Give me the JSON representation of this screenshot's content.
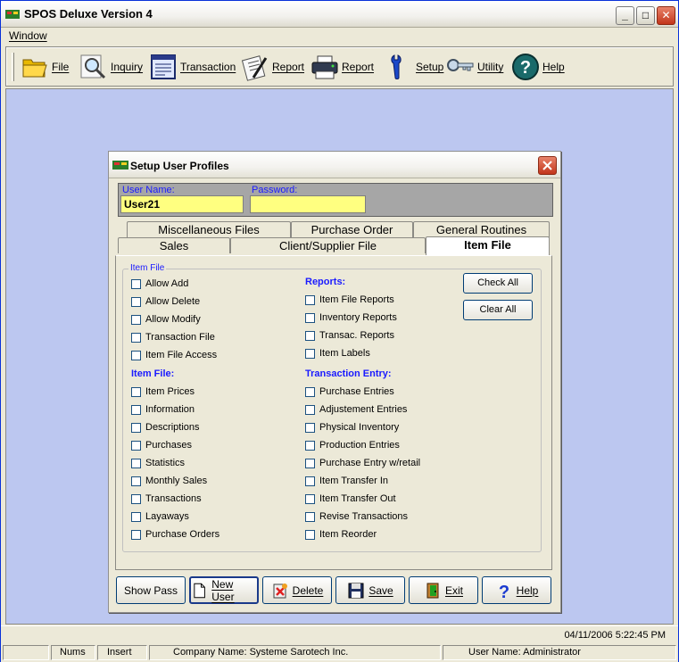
{
  "app": {
    "title": "SPOS Deluxe Version 4"
  },
  "window_controls": {
    "minimize": "_",
    "maximize": "□",
    "close": "✕"
  },
  "menu": {
    "window": "Window"
  },
  "toolbar": [
    {
      "label": "File",
      "icon": "folder-icon"
    },
    {
      "label": "Inquiry",
      "icon": "magnifier-icon"
    },
    {
      "label": "Transaction",
      "icon": "document-icon"
    },
    {
      "label": "Report",
      "icon": "clipboard-pen-icon"
    },
    {
      "label": "Report",
      "icon": "printer-icon"
    },
    {
      "label": "Setup",
      "icon": "wrench-icon"
    },
    {
      "label": "Utility",
      "icon": "keys-icon"
    },
    {
      "label": "Help",
      "icon": "help-icon"
    }
  ],
  "dialog": {
    "title": "Setup User Profiles",
    "user_name_label": "User Name:",
    "user_name_value": "User21",
    "password_label": "Password:",
    "password_value": "",
    "tabs_back": [
      "Miscellaneous Files",
      "Purchase Order",
      "General Routines"
    ],
    "tabs_front": [
      "Sales",
      "Client/Supplier File",
      "Item File"
    ],
    "active_tab": "Item File",
    "group_label": "Item File",
    "left_top": [
      "Allow Add",
      "Allow Delete",
      "Allow Modify",
      "Transaction File",
      "Item File Access"
    ],
    "left_section": "Item File:",
    "left_bottom": [
      "Item Prices",
      "Information",
      "Descriptions",
      "Purchases",
      "Statistics",
      "Monthly Sales",
      "Transactions",
      "Layaways",
      "Purchase Orders"
    ],
    "reports_section": "Reports:",
    "reports": [
      "Item File Reports",
      "Inventory Reports",
      "Transac. Reports",
      "Item Labels"
    ],
    "transaction_section": "Transaction Entry:",
    "transaction_entries": [
      "Purchase Entries",
      "Adjustement Entries",
      "Physical Inventory",
      "Production Entries",
      "Purchase Entry w/retail",
      "Item Transfer In",
      "Item Transfer Out",
      "Revise Transactions",
      "Item Reorder"
    ],
    "check_all": "Check All",
    "clear_all": "Clear All",
    "buttons": {
      "show_pass": "Show Pass",
      "new_user": "New User",
      "delete": "Delete",
      "save": "Save",
      "exit": "Exit",
      "help": "Help"
    }
  },
  "datetime": "04/11/2006  5:22:45 PM",
  "status": {
    "nums": "Nums",
    "insert": "Insert",
    "company": "Company Name: Systeme Sarotech Inc.",
    "user": "User Name: Administrator"
  }
}
